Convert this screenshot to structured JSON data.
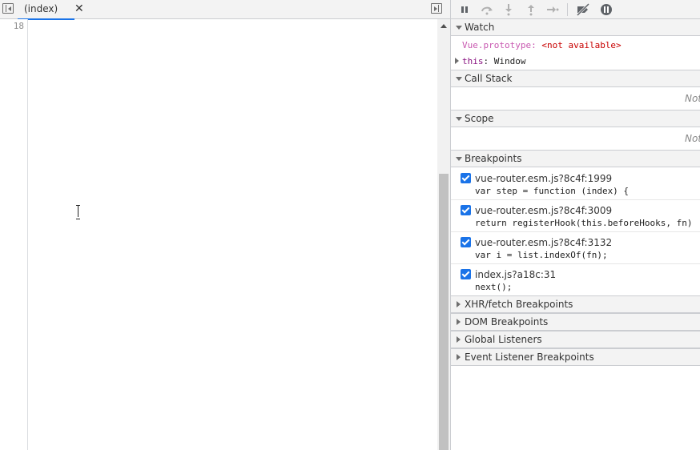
{
  "editor": {
    "tab_label": "(index)",
    "tab_close": "✕",
    "line_number": "18"
  },
  "sidebar": {
    "watch": {
      "title": "Watch",
      "items": [
        {
          "expression": "Vue.prototype",
          "value": "<not available>"
        },
        {
          "key": "this",
          "value": "Window"
        }
      ]
    },
    "call_stack": {
      "title": "Call Stack",
      "status": "Not paused"
    },
    "scope": {
      "title": "Scope",
      "status": "Not paused"
    },
    "breakpoints": {
      "title": "Breakpoints",
      "items": [
        {
          "location": "vue-router.esm.js?8c4f:1999",
          "code": "var step = function (index) {",
          "checked": true
        },
        {
          "location": "vue-router.esm.js?8c4f:3009",
          "code": "return registerHook(this.beforeHooks, fn)",
          "checked": true
        },
        {
          "location": "vue-router.esm.js?8c4f:3132",
          "code": "var i = list.indexOf(fn);",
          "checked": true
        },
        {
          "location": "index.js?a18c:31",
          "code": "next();",
          "checked": true
        }
      ]
    },
    "collapsed_panes": [
      "XHR/fetch Breakpoints",
      "DOM Breakpoints",
      "Global Listeners",
      "Event Listener Breakpoints"
    ]
  },
  "colors": {
    "accent": "#1a73e8",
    "watch_error": "#c80000",
    "keyword": "#881280"
  }
}
